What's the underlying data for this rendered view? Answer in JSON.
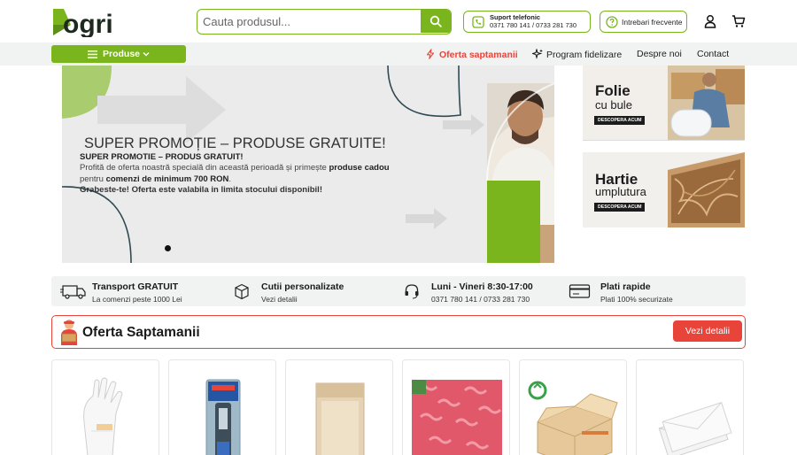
{
  "brand": {
    "name": "Rogri",
    "accent": "#7ab51d",
    "red": "#e8443a"
  },
  "search": {
    "placeholder": "Cauta produsul...",
    "value": ""
  },
  "header": {
    "support_title": "Suport telefonic",
    "support_numbers": "0371 780 141 / 0733 281 730",
    "faq_label": "Intrebari frecvente",
    "icons": [
      "search-icon",
      "phone-icon",
      "help-icon",
      "user-icon",
      "cart-icon"
    ]
  },
  "nav": {
    "produse": "Produse",
    "oferta": "Oferta saptamanii",
    "fidelizare": "Program fidelizare",
    "despre": "Despre noi",
    "contact": "Contact"
  },
  "hero": {
    "title": "SUPER PROMOȚIE – PRODUSE GRATUITE!",
    "line1": "SUPER PROMOTIE – PRODUS GRATUIT!",
    "line2_a": "Profită de oferta noastră specială din această perioadă și primește ",
    "line2_b": "produse cadou",
    "line3_a": "pentru ",
    "line3_b": "comenzi de minimum 700 RON",
    "line3_c": ".",
    "line4": "Grabeste-te! Oferta este valabila in limita stocului disponibil!"
  },
  "promos": [
    {
      "title1": "Folie",
      "title2": "cu bule",
      "button": "DESCOPERA ACUM"
    },
    {
      "title1": "Hartie",
      "title2": "umplutura",
      "button": "DESCOPERA ACUM"
    }
  ],
  "features": [
    {
      "title": "Transport GRATUIT",
      "subtitle": "La comenzi peste 1000 Lei",
      "icon": "truck-icon"
    },
    {
      "title": "Cutii personalizate",
      "subtitle": "Vezi detalii",
      "icon": "box-icon"
    },
    {
      "title": "Luni - Vineri 8:30-17:00",
      "subtitle": "0371 780 141 / 0733 281 730",
      "icon": "headset-icon"
    },
    {
      "title": "Plati rapide",
      "subtitle": "Plati 100% securizate",
      "icon": "card-icon"
    }
  ],
  "oferta": {
    "title": "Oferta Saptamanii",
    "button": "Vezi detalii"
  }
}
